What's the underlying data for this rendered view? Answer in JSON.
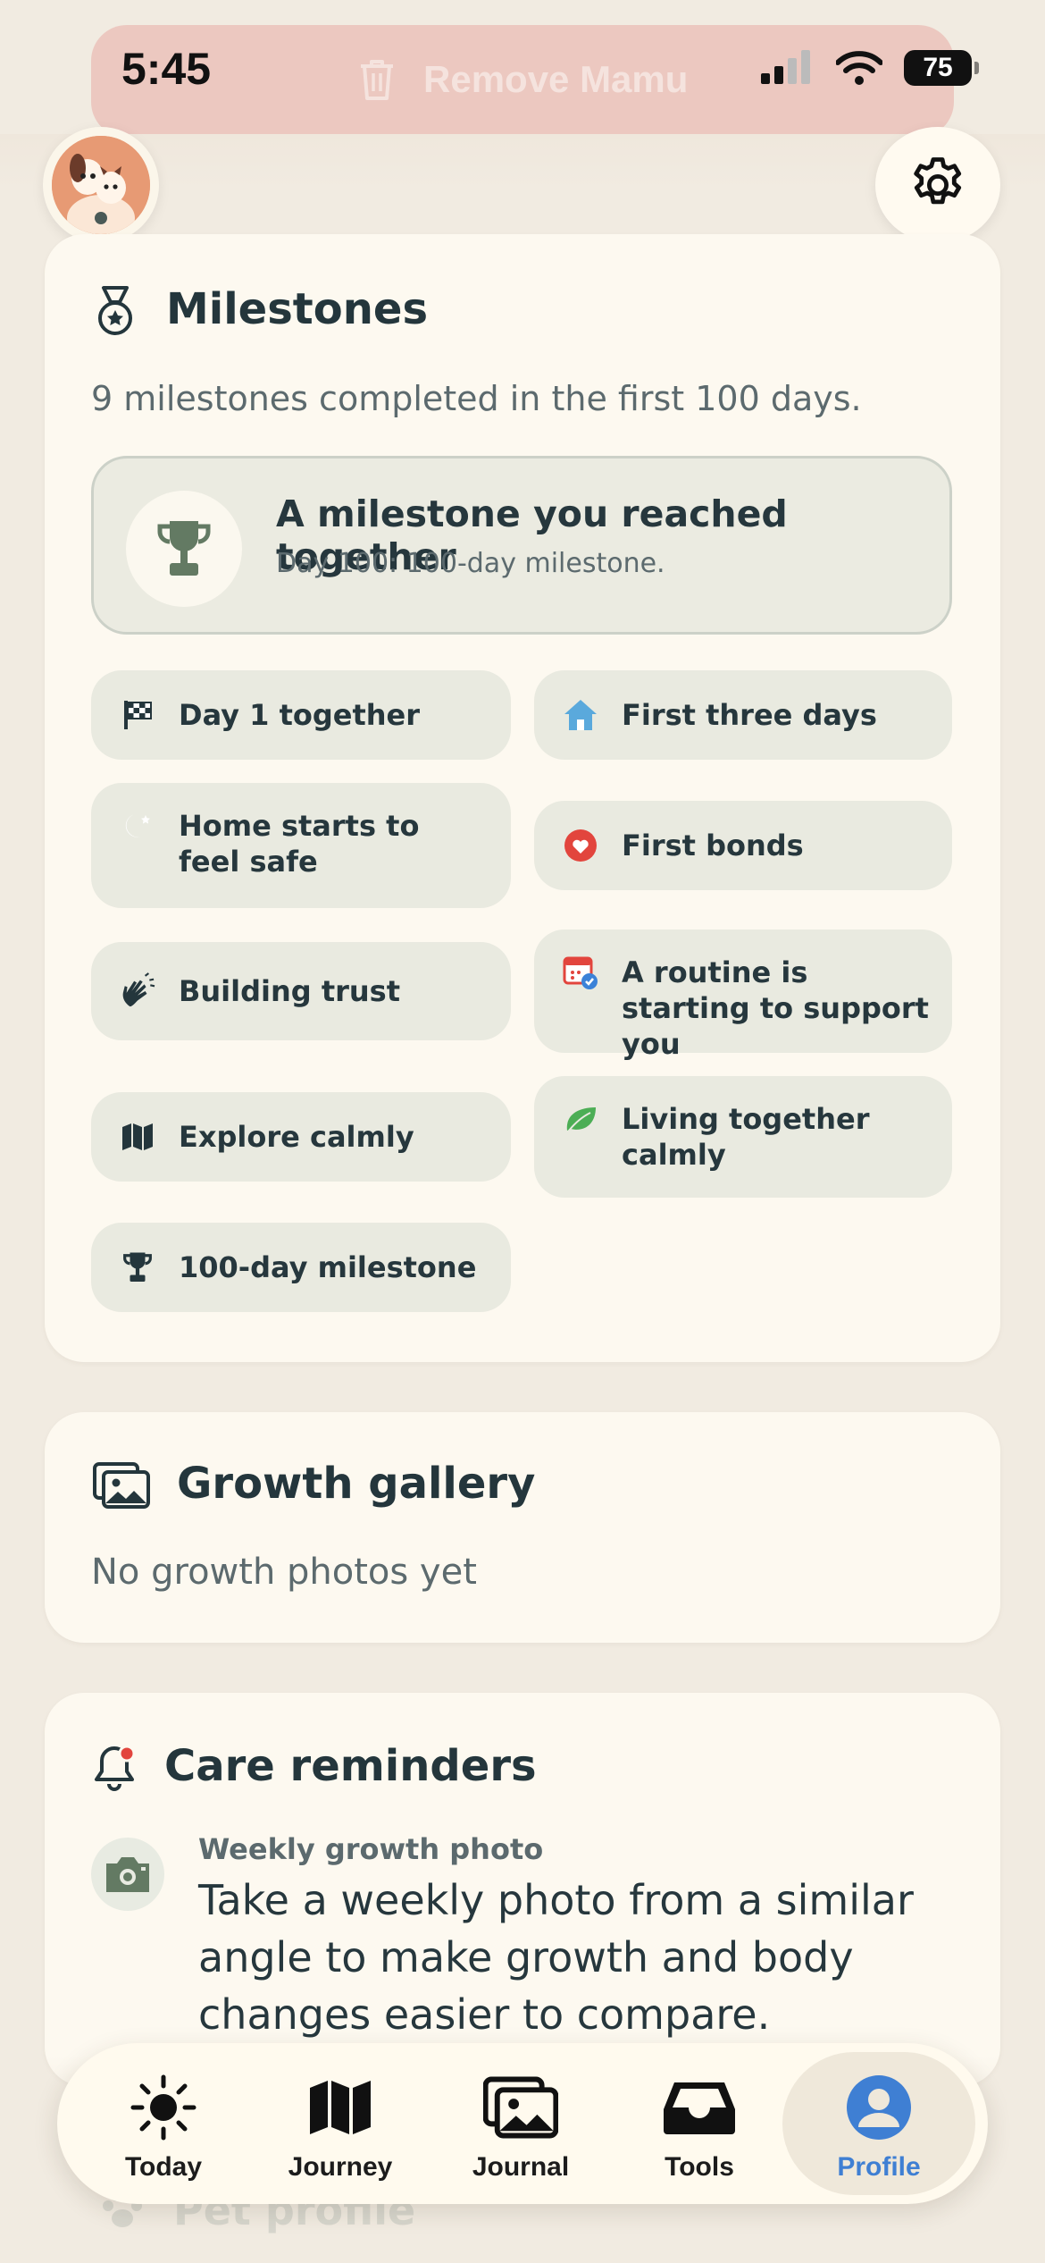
{
  "status_bar": {
    "time": "5:45",
    "battery": "75"
  },
  "header": {
    "danger_action": "Remove Mamu"
  },
  "milestones": {
    "title": "Milestones",
    "summary": "9 milestones completed in the first 100 days.",
    "highlight": {
      "title": "A milestone you reached together",
      "subtitle": "Day 100: 100-day milestone."
    },
    "items": [
      {
        "label": "Day 1 together",
        "icon": "checkered-flag-icon"
      },
      {
        "label": "First three days",
        "icon": "house-icon"
      },
      {
        "label": "Home starts to feel safe",
        "icon": "moon-star-icon"
      },
      {
        "label": "First bonds",
        "icon": "heart-icon"
      },
      {
        "label": "Building trust",
        "icon": "waving-hand-icon"
      },
      {
        "label": "A routine is starting to support you",
        "icon": "calendar-check-icon"
      },
      {
        "label": "Explore calmly",
        "icon": "map-icon"
      },
      {
        "label": "Living together calmly",
        "icon": "leaf-icon"
      },
      {
        "label": "100-day milestone",
        "icon": "trophy-icon"
      }
    ]
  },
  "gallery": {
    "title": "Growth gallery",
    "empty": "No growth photos yet"
  },
  "reminders": {
    "title": "Care reminders",
    "item": {
      "label": "Weekly growth photo",
      "text": "Take a weekly photo from a similar angle to make growth and body changes easier to compare."
    }
  },
  "below": {
    "label": "Pet profile"
  },
  "tabs": [
    {
      "label": "Today",
      "icon": "sun-icon"
    },
    {
      "label": "Journey",
      "icon": "map-icon"
    },
    {
      "label": "Journal",
      "icon": "photos-icon"
    },
    {
      "label": "Tools",
      "icon": "tray-icon"
    },
    {
      "label": "Profile",
      "icon": "person-icon",
      "active": true
    }
  ],
  "colors": {
    "accent": "#3f7fd3",
    "card": "#fdf9f0",
    "chip": "#e9eae0",
    "background": "#f1ebe1"
  }
}
